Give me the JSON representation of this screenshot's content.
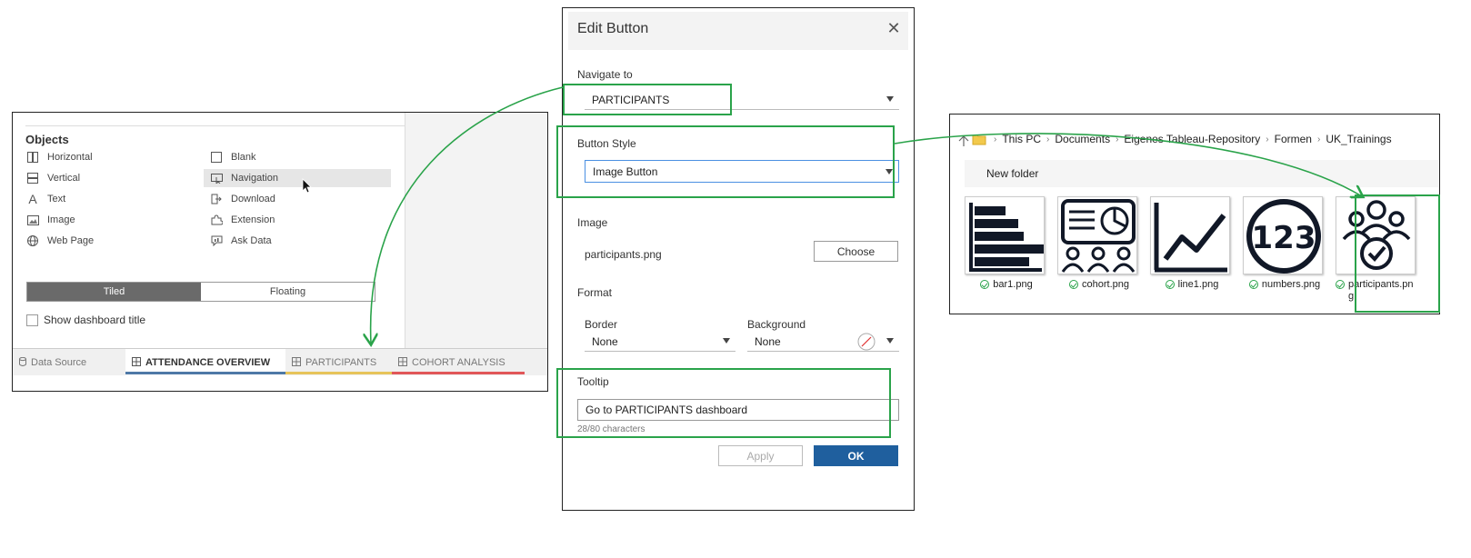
{
  "left_panel": {
    "objects_title": "Objects",
    "objects_left": [
      {
        "label": "Horizontal",
        "icon": "horizontal-icon"
      },
      {
        "label": "Vertical",
        "icon": "vertical-icon"
      },
      {
        "label": "Text",
        "icon": "text-icon"
      },
      {
        "label": "Image",
        "icon": "image-icon"
      },
      {
        "label": "Web Page",
        "icon": "globe-icon"
      }
    ],
    "objects_right": [
      {
        "label": "Blank",
        "icon": "blank-icon"
      },
      {
        "label": "Navigation",
        "icon": "navigation-icon"
      },
      {
        "label": "Download",
        "icon": "download-icon"
      },
      {
        "label": "Extension",
        "icon": "extension-icon"
      },
      {
        "label": "Ask Data",
        "icon": "ask-data-icon"
      }
    ],
    "layout_toggle": {
      "tiled": "Tiled",
      "floating": "Floating"
    },
    "show_title_label": "Show dashboard title",
    "tabs": [
      {
        "label": "Data Source",
        "icon": "database-icon"
      },
      {
        "label": "ATTENDANCE OVERVIEW",
        "color": "#4e79a7"
      },
      {
        "label": "PARTICIPANTS",
        "color": "#e7c45a"
      },
      {
        "label": "COHORT ANALYSIS",
        "color": "#e15759"
      }
    ]
  },
  "dialog": {
    "title": "Edit Button",
    "navigate_to_label": "Navigate to",
    "navigate_to_value": "PARTICIPANTS",
    "button_style_label": "Button Style",
    "button_style_value": "Image Button",
    "image_label": "Image",
    "image_file": "participants.png",
    "choose_label": "Choose",
    "format_label": "Format",
    "border_label": "Border",
    "border_value": "None",
    "background_label": "Background",
    "background_value": "None",
    "tooltip_label": "Tooltip",
    "tooltip_value": "Go to PARTICIPANTS dashboard",
    "char_count": "28/80 characters",
    "apply_label": "Apply",
    "ok_label": "OK"
  },
  "explorer": {
    "breadcrumbs": [
      "This PC",
      "Documents",
      "Eigenes Tableau-Repository",
      "Formen",
      "UK_Trainings"
    ],
    "new_folder_label": "New folder",
    "files": [
      {
        "name": "bar1.png"
      },
      {
        "name": "cohort.png"
      },
      {
        "name": "line1.png"
      },
      {
        "name": "numbers.png"
      },
      {
        "name": "participants.png"
      }
    ]
  },
  "colors": {
    "highlight": "#2aa34a",
    "ok_button": "#1f5f9e"
  }
}
